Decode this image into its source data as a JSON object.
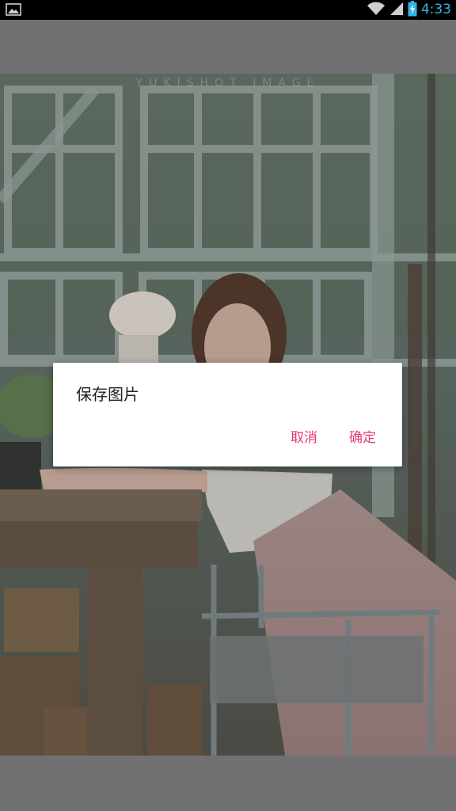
{
  "status_bar": {
    "time": "4:33",
    "icons": [
      "image-notification-icon",
      "wifi-icon",
      "cell-signal-icon",
      "battery-charging-icon"
    ],
    "accent_color": "#33b5e5"
  },
  "photo": {
    "watermark": "YUKISHOT IMAGE"
  },
  "dialog": {
    "title": "保存图片",
    "cancel_label": "取消",
    "confirm_label": "确定",
    "button_color": "#e93775"
  }
}
